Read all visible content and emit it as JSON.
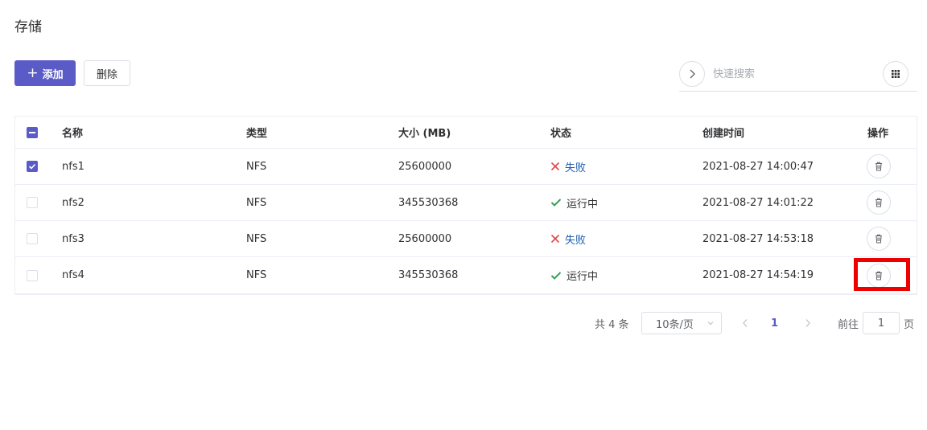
{
  "page": {
    "title": "存储"
  },
  "toolbar": {
    "add_label": "添加",
    "delete_label": "删除"
  },
  "search": {
    "placeholder": "快速搜索",
    "value": ""
  },
  "table": {
    "columns": {
      "name": "名称",
      "type": "类型",
      "size": "大小 (MB)",
      "status": "状态",
      "created": "创建时间",
      "actions": "操作"
    },
    "rows": [
      {
        "checked": true,
        "name": "nfs1",
        "type": "NFS",
        "size": "25600000",
        "status": "失败",
        "status_kind": "failed",
        "created": "2021-08-27 14:00:47"
      },
      {
        "checked": false,
        "name": "nfs2",
        "type": "NFS",
        "size": "345530368",
        "status": "运行中",
        "status_kind": "running",
        "created": "2021-08-27 14:01:22"
      },
      {
        "checked": false,
        "name": "nfs3",
        "type": "NFS",
        "size": "25600000",
        "status": "失败",
        "status_kind": "failed",
        "created": "2021-08-27 14:53:18"
      },
      {
        "checked": false,
        "name": "nfs4",
        "type": "NFS",
        "size": "345530368",
        "status": "运行中",
        "status_kind": "running",
        "created": "2021-08-27 14:54:19"
      }
    ]
  },
  "pagination": {
    "total_text": "共 4 条",
    "page_size": "10条/页",
    "current_page": "1",
    "goto_label": "前往",
    "goto_value": "1",
    "page_unit": "页"
  },
  "colors": {
    "primary": "#5b5bc7",
    "failed": "#e04848",
    "running": "#3a9f55",
    "highlight": "#ee0000"
  },
  "icons": {
    "add": "plus-icon",
    "search_toggle": "chevron-right-icon",
    "columns": "grid-icon",
    "delete_row": "trash-icon",
    "failed": "close-icon",
    "running": "check-icon"
  }
}
